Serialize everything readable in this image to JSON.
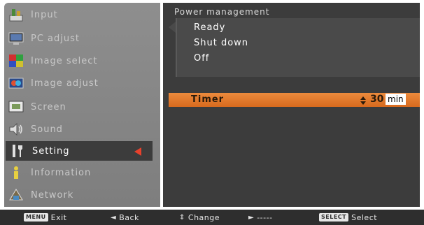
{
  "menu": {
    "items": [
      {
        "label": "Input",
        "icon": "input-icon"
      },
      {
        "label": "PC adjust",
        "icon": "pc-adjust-icon"
      },
      {
        "label": "Image select",
        "icon": "image-select-icon"
      },
      {
        "label": "Image adjust",
        "icon": "image-adjust-icon"
      },
      {
        "label": "Screen",
        "icon": "screen-icon"
      },
      {
        "label": "Sound",
        "icon": "sound-icon"
      },
      {
        "label": "Setting",
        "icon": "setting-icon"
      },
      {
        "label": "Information",
        "icon": "information-icon"
      },
      {
        "label": "Network",
        "icon": "network-icon"
      }
    ],
    "active_index": 6
  },
  "panel": {
    "title": "Power management",
    "options": [
      "Ready",
      "Shut down",
      "Off"
    ],
    "timer": {
      "label": "Timer",
      "value": "30",
      "unit": "min"
    }
  },
  "status_bar": {
    "exit": {
      "key": "MENU",
      "label": "Exit"
    },
    "back": {
      "glyph": "◄",
      "label": "Back"
    },
    "change": {
      "glyph": "⇕",
      "label": "Change"
    },
    "next": {
      "glyph": "►",
      "label": "-----"
    },
    "select": {
      "key": "SELECT",
      "label": "Select"
    }
  },
  "colors": {
    "accent_orange": "#e07a2c",
    "active_arrow_red": "#e8412c",
    "panel_dark": "#3c3c3c",
    "menu_gray": "#888888"
  }
}
